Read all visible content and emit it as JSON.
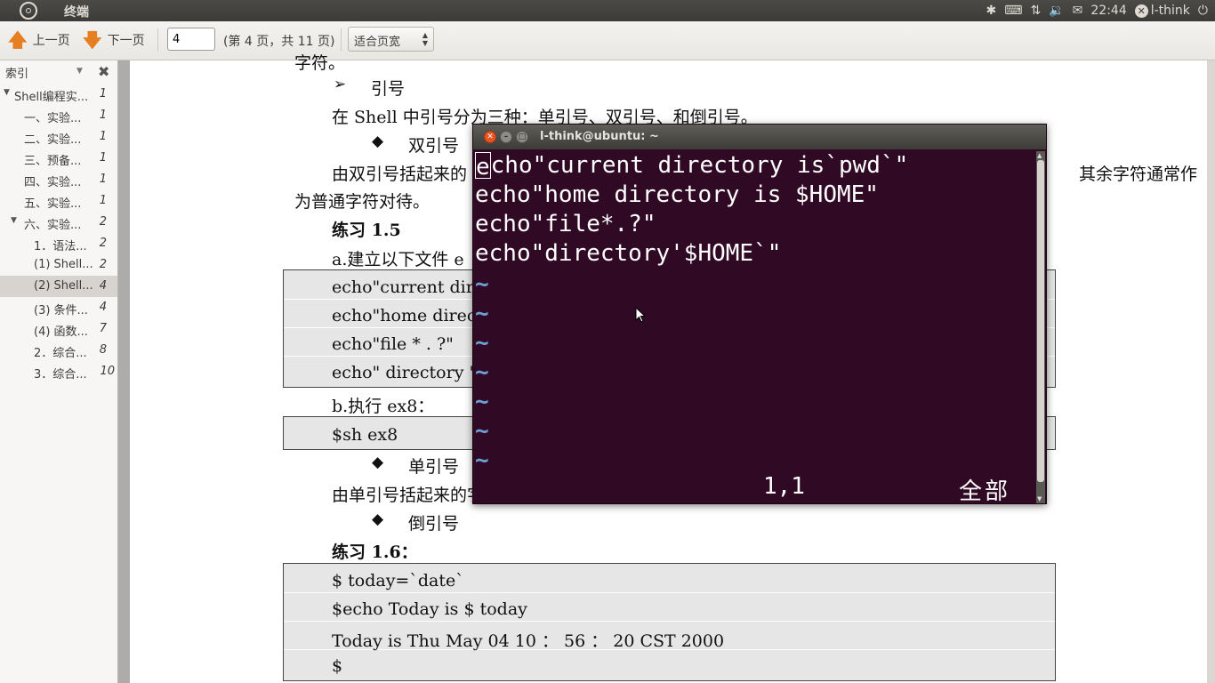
{
  "panel": {
    "app_name": "终端",
    "time": "22:44",
    "user": "l-think",
    "icons": [
      "bluetooth-icon",
      "keyboard-icon",
      "network-icon",
      "volume-icon",
      "mail-icon",
      "user-icon",
      "power-icon"
    ]
  },
  "toolbar": {
    "prev_label": "上一页",
    "next_label": "下一页",
    "page_value": "4",
    "page_info": "(第 4 页，共 11 页)",
    "zoom_value": "适合页宽"
  },
  "sidebar": {
    "title": "索引",
    "items": [
      {
        "label": "Shell编程实...",
        "page": "1"
      },
      {
        "label": "一、实验...",
        "page": "1"
      },
      {
        "label": "二、实验...",
        "page": "1"
      },
      {
        "label": "三、预备...",
        "page": "1"
      },
      {
        "label": "四、实验...",
        "page": "1"
      },
      {
        "label": "五、实验...",
        "page": "1"
      },
      {
        "label": "六、实验...",
        "page": "2"
      },
      {
        "label": "1．语法...",
        "page": "2"
      },
      {
        "label": "(1) Shell...",
        "page": "2"
      },
      {
        "label": "(2) Shell...",
        "page": "4"
      },
      {
        "label": "(3) 条件...",
        "page": "4"
      },
      {
        "label": "(4) 函数...",
        "page": "7"
      },
      {
        "label": "2．综合...",
        "page": "8"
      },
      {
        "label": "3．综合...",
        "page": "10"
      }
    ]
  },
  "document": {
    "top_fragment": "字符。",
    "quote_heading": "引号",
    "quote_intro": "在 Shell 中引号分为三种：单引号、双引号、和倒引号。",
    "double_quote_heading": "双引号",
    "double_quote_desc_1": "由双引号括起来的",
    "double_quote_desc_2": "为普通字符对待。",
    "double_quote_desc_right": "其余字符通常作",
    "ex15_title": "练习 1.5",
    "ex15_step_a": "a.建立以下文件 e",
    "ex15_box": [
      "echo\"current directory is`pwd`\"",
      "echo\"home directory is $ HOME\"",
      "echo\"file * . ?\"",
      "echo\" directory ' $HOME ' \""
    ],
    "ex15_step_b": "b.执行 ex8：",
    "ex15_cmd": "$sh ex8",
    "single_quote_heading": "单引号",
    "single_quote_desc": "由单引号括起来的字符都作为普通字符出现。",
    "back_quote_heading": "倒引号",
    "ex16_title": "练习 1.6：",
    "ex16_box": [
      "$ today=`date`",
      "$echo Today is $ today",
      "Today is Thu May 04 10 ： 56 ： 20 CST 2000",
      "$"
    ]
  },
  "terminal": {
    "title": "l-think@ubuntu: ~",
    "lines": [
      "echo\"current directory is`pwd`\"",
      "echo\"home directory is $HOME\"",
      "echo\"file*.?\"",
      "echo\"directory'$HOME`\""
    ],
    "tilde": "~",
    "status_pos": "1,1",
    "status_all": "全部"
  }
}
